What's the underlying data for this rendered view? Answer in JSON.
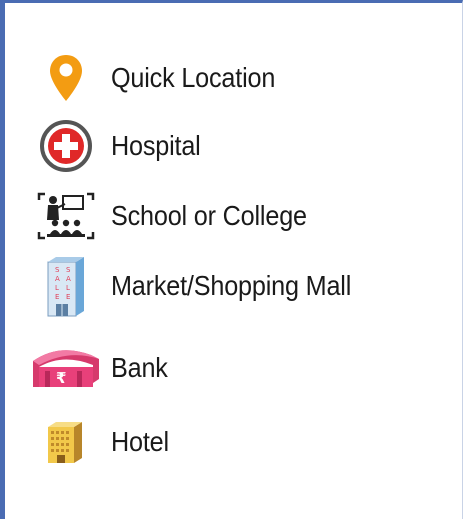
{
  "legend": {
    "items": [
      {
        "label": "Quick Location",
        "icon": "map-pin-icon",
        "color": "#f39c12"
      },
      {
        "label": "Hospital",
        "icon": "hospital-cross-icon",
        "color": "#e02828"
      },
      {
        "label": "School or College",
        "icon": "classroom-icon",
        "color": "#222222"
      },
      {
        "label": "Market/Shopping Mall",
        "icon": "shopping-mall-building-icon",
        "color": "#6aa7d8"
      },
      {
        "label": "Bank",
        "icon": "bank-building-icon",
        "color": "#e8407a"
      },
      {
        "label": "Hotel",
        "icon": "hotel-building-icon",
        "color": "#e8b83a"
      }
    ]
  }
}
